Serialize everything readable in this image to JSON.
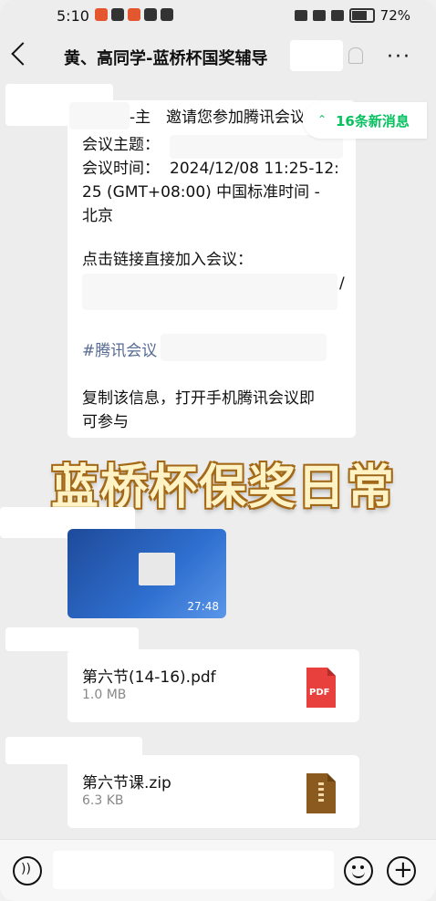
{
  "status_bar": {
    "time": "5:10",
    "battery": "72%"
  },
  "header": {
    "title": "黄、高同学-蓝桥杯国奖辅导"
  },
  "new_messages": "16条新消息",
  "meeting_message": {
    "sender_fragment": "-主",
    "invite": "邀请您参加腾讯会议",
    "topic_label": "会议主题：",
    "time_label": "会议时间：",
    "time_line1": "2024/12/08 11:25-12:",
    "time_line2": "25 (GMT+08:00) 中国标准时间 -",
    "time_line3": "北京",
    "link_label": "点击链接直接加入会议：",
    "link_fragment": "/",
    "hashtag": "#腾讯会议",
    "footer_line1": "复制该信息，打开手机腾讯会议即",
    "footer_line2": "可参与"
  },
  "banner": "蓝桥杯保奖日常",
  "video": {
    "duration": "27:48"
  },
  "files": [
    {
      "name": "第六节(14-16).pdf",
      "size": "1.0 MB",
      "type_label": "PDF",
      "icon": "pdf-icon"
    },
    {
      "name": "第六节课.zip",
      "size": "6.3 KB",
      "icon": "zip-icon"
    }
  ],
  "input_bar": {
    "placeholder": ""
  },
  "colors": {
    "accent": "#07c160",
    "pdf": "#e8413d",
    "zip": "#8a5a1e"
  }
}
